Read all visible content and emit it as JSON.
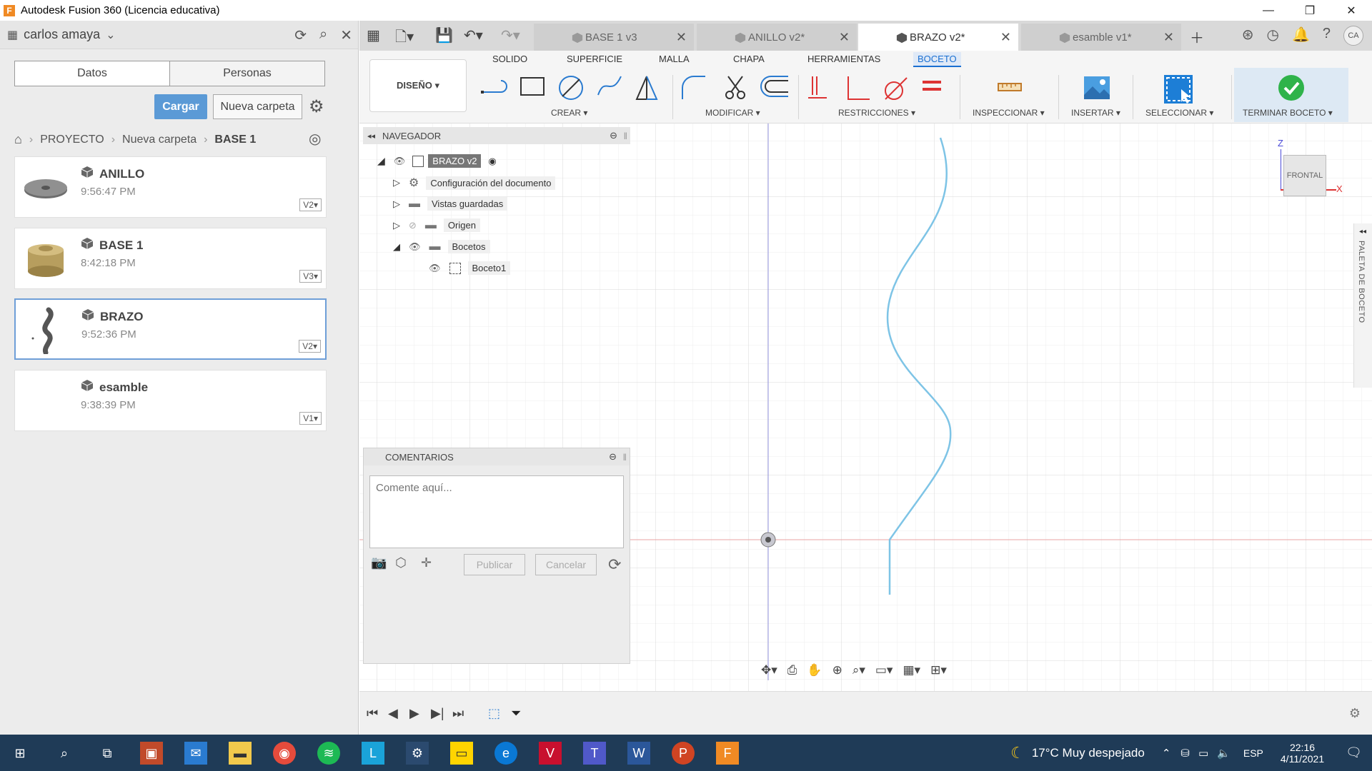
{
  "window": {
    "title": "Autodesk Fusion 360 (Licencia educativa)",
    "app_icon": "F"
  },
  "data_panel": {
    "user": "carlos amaya",
    "tabs": [
      "Datos",
      "Personas"
    ],
    "upload_label": "Cargar",
    "new_folder_label": "Nueva carpeta",
    "breadcrumb": [
      "PROYECTO",
      "Nueva carpeta",
      "BASE 1"
    ],
    "items": [
      {
        "name": "ANILLO",
        "time": "9:56:47 PM",
        "version": "V2▾"
      },
      {
        "name": "BASE 1",
        "time": "8:42:18 PM",
        "version": "V3▾"
      },
      {
        "name": "BRAZO",
        "time": "9:52:36 PM",
        "version": "V2▾"
      },
      {
        "name": "esamble",
        "time": "9:38:39 PM",
        "version": "V1▾"
      }
    ]
  },
  "doc_tabs": [
    {
      "label": "BASE 1 v3",
      "active": false
    },
    {
      "label": "ANILLO v2*",
      "active": false
    },
    {
      "label": "BRAZO v2*",
      "active": true
    },
    {
      "label": "esamble v1*",
      "active": false
    }
  ],
  "user_initials": "CA",
  "ribbon": {
    "workspace": "DISEÑO ▾",
    "tabs": [
      "SOLIDO",
      "SUPERFICIE",
      "MALLA",
      "CHAPA",
      "HERRAMIENTAS",
      "BOCETO"
    ],
    "active_tab": "BOCETO",
    "groups": [
      "CREAR ▾",
      "MODIFICAR ▾",
      "RESTRICCIONES ▾",
      "INSPECCIONAR ▾",
      "INSERTAR ▾",
      "SELECCIONAR ▾",
      "TERMINAR BOCETO ▾"
    ]
  },
  "browser": {
    "title": "NAVEGADOR",
    "root": "BRAZO v2",
    "nodes": [
      "Configuración del documento",
      "Vistas guardadas",
      "Origen",
      "Bocetos"
    ],
    "sketch": "Boceto1"
  },
  "comments": {
    "title": "COMENTARIOS",
    "placeholder": "Comente aquí...",
    "publish": "Publicar",
    "cancel": "Cancelar"
  },
  "viewcube": {
    "face": "FRONTAL",
    "axis_z": "Z",
    "axis_x": "X"
  },
  "sketch_palette_label": "PALETA DE BOCETO",
  "taskbar": {
    "weather": "17°C  Muy despejado",
    "lang": "ESP",
    "time": "22:16",
    "date": "4/11/2021"
  },
  "colors": {
    "accent": "#1a6fd1",
    "sketch_line": "#7ec4e6",
    "taskbar": "#1f3b57"
  }
}
